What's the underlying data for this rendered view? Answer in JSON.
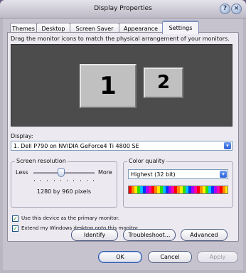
{
  "window": {
    "title": "Display Properties"
  },
  "title_buttons": {
    "help": "?",
    "close": "×"
  },
  "tabs": [
    {
      "label": "Themes"
    },
    {
      "label": "Desktop"
    },
    {
      "label": "Screen Saver"
    },
    {
      "label": "Appearance"
    },
    {
      "label": "Settings",
      "active": true
    }
  ],
  "settings": {
    "instructions": "Drag the monitor icons to match the physical arrangement of your monitors.",
    "monitors": [
      {
        "label": "1"
      },
      {
        "label": "2"
      }
    ],
    "display_label": "Display:",
    "display_value": "1. Dell P790 on NVIDIA GeForce4 Ti 4800 SE",
    "resolution": {
      "group_title": "Screen resolution",
      "less": "Less",
      "more": "More",
      "value_text": "1280 by 960 pixels",
      "slider_fraction": 0.45
    },
    "color": {
      "group_title": "Color quality",
      "value": "Highest (32 bit)"
    },
    "checks": [
      {
        "label": "Use this device as the primary monitor.",
        "checked": true
      },
      {
        "label": "Extend my Windows desktop onto this monitor.",
        "checked": true
      }
    ],
    "buttons": {
      "identify": "Identify",
      "troubleshoot": "Troubleshoot...",
      "advanced": "Advanced"
    }
  },
  "footer": {
    "ok": "OK",
    "cancel": "Cancel",
    "apply": "Apply"
  },
  "colors": {
    "title_bar": "#cfccd8",
    "panel": "#eceaf0",
    "monitor_area": "#4c4c4c",
    "tab_highlight": "#f8b23a"
  }
}
